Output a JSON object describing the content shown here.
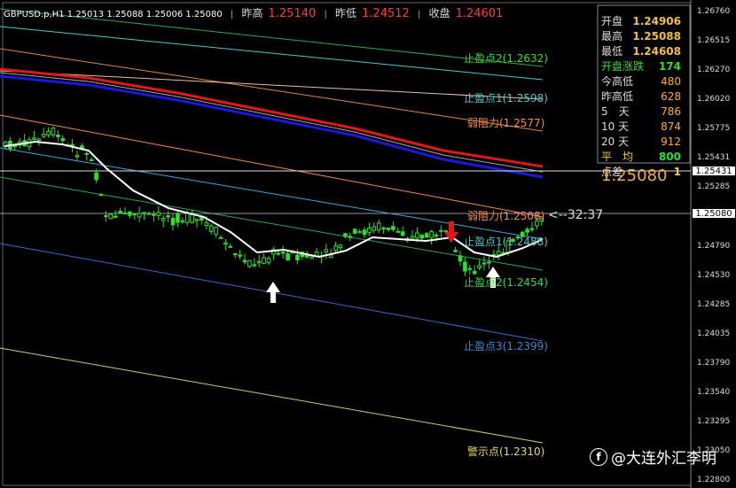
{
  "header": {
    "symbol": "GBPUSD.p,H1",
    "ohlc": "1.25013 1.25088 1.25006 1.25080",
    "yesterday_high_label": "昨高",
    "yesterday_high": "1.25140",
    "yesterday_low_label": "昨低",
    "yesterday_low": "1.24512",
    "yesterday_close_label": "收盘",
    "yesterday_close": "1.24601"
  },
  "stats": {
    "open_label": "开盘",
    "open": "1.24906",
    "high_label": "最高",
    "high": "1.25088",
    "low_label": "最低",
    "low": "1.24608",
    "change_label": "开盘涨跌",
    "change": "174",
    "today_range_label": "今高低",
    "today_range": "480",
    "yday_range_label": "昨高低",
    "yday_range": "628",
    "d5_label": "5　天",
    "d5": "786",
    "d10_label": "10 天",
    "d10": "874",
    "d20_label": "20 天",
    "d20": "912",
    "avg_label": "平　均",
    "avg": "800",
    "spread_label": "点差",
    "spread": "1",
    "big_price": "1.25080"
  },
  "axis": {
    "ticks": [
      "1.26760",
      "1.26515",
      "1.26270",
      "1.26020",
      "1.25775",
      "1.25431",
      "1.25285",
      "1.25080",
      "1.24790",
      "1.24530",
      "1.24285",
      "1.24035",
      "1.23790",
      "1.23540",
      "1.23295",
      "1.23050",
      "1.22800"
    ],
    "current_box": "1.25080",
    "ref_box": "1.25431"
  },
  "levels": {
    "tp2_upper": "止盈点2(1.2632)",
    "tp1_upper": "止盈点1(1.2598)",
    "weak_res1": "弱阻力(1.2577)",
    "weak_res2": "弱阻力(1.2508)",
    "countdown": "<--32:37",
    "tp1_lower": "止盈点1(1.2488)",
    "tp2_lower": "止盈点2(1.2454)",
    "tp3_lower": "止盈点3(1.2399)",
    "warn": "警示点(1.2310)"
  },
  "watermark": {
    "icon": "f",
    "text": "@大连外汇李明"
  },
  "colors": {
    "bull": "#33dd33",
    "bear": "#33dd33",
    "red_ma": "#e01818",
    "blue_ma": "#1818e0",
    "white_ma": "#ffffff"
  }
}
